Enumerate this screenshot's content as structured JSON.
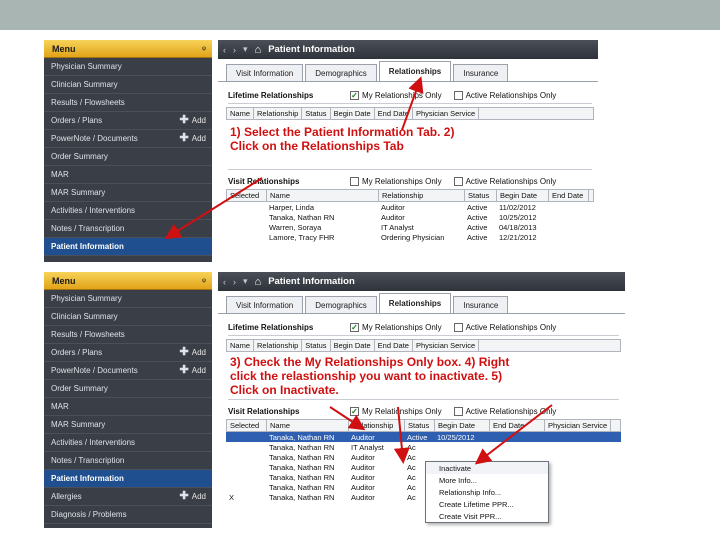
{
  "menu": {
    "header": "Menu",
    "pin": "ᵠ",
    "add_label": "Add",
    "items1": [
      {
        "label": "Physician Summary",
        "add": false
      },
      {
        "label": "Clinician Summary",
        "add": false
      },
      {
        "label": "Results / Flowsheets",
        "add": false
      },
      {
        "label": "Orders / Plans",
        "add": true
      },
      {
        "label": "PowerNote / Documents",
        "add": true
      },
      {
        "label": "Order Summary",
        "add": false
      },
      {
        "label": "MAR",
        "add": false
      },
      {
        "label": "MAR Summary",
        "add": false
      },
      {
        "label": "Activities / Interventions",
        "add": false
      },
      {
        "label": "Notes / Transcription",
        "add": false
      },
      {
        "label": "Patient Information",
        "add": false,
        "active": true
      }
    ],
    "items2": [
      {
        "label": "Physician Summary",
        "add": false
      },
      {
        "label": "Clinician Summary",
        "add": false
      },
      {
        "label": "Results / Flowsheets",
        "add": false
      },
      {
        "label": "Orders / Plans",
        "add": true
      },
      {
        "label": "PowerNote / Documents",
        "add": true
      },
      {
        "label": "Order Summary",
        "add": false
      },
      {
        "label": "MAR",
        "add": false
      },
      {
        "label": "MAR Summary",
        "add": false
      },
      {
        "label": "Activities / Interventions",
        "add": false
      },
      {
        "label": "Notes / Transcription",
        "add": false
      },
      {
        "label": "Patient Information",
        "add": false,
        "active": true
      },
      {
        "label": "Allergies",
        "add": true
      },
      {
        "label": "Diagnosis / Problems",
        "add": false
      }
    ]
  },
  "titlebar": {
    "back": "‹",
    "forward": "›",
    "dropdown": "▾",
    "title": "Patient Information"
  },
  "tabs": [
    "Visit Information",
    "Demographics",
    "Relationships",
    "Insurance"
  ],
  "lifetime": {
    "title": "Lifetime Relationships",
    "my_only": "My Relationships Only",
    "active_only": "Active Relationships Only",
    "headers": [
      "Name",
      "Relationship",
      "Status",
      "Begin Date",
      "End Date",
      "Physician Service"
    ],
    "headers2": [
      "Name",
      "Relationship",
      "Status",
      "Begin Date",
      "End Date",
      "Physician Service"
    ]
  },
  "visit": {
    "title": "Visit Relationships",
    "my_only": "My Relationships Only",
    "active_only": "Active Relationships Only",
    "headers": [
      "Selected",
      "Name",
      "Relationship",
      "Status",
      "Begin Date",
      "End Date"
    ],
    "rows": [
      {
        "name": "Harper, Linda",
        "rel": "Auditor",
        "status": "Active",
        "date": "11/02/2012"
      },
      {
        "name": "Tanaka, Nathan RN",
        "rel": "Auditor",
        "status": "Active",
        "date": "10/25/2012"
      },
      {
        "name": "Warren, Soraya",
        "rel": "IT Analyst",
        "status": "Active",
        "date": "04/18/2013"
      },
      {
        "name": "Lamore, Tracy FHR",
        "rel": "Ordering Physician",
        "status": "Active",
        "date": "12/21/2012"
      }
    ],
    "headers2": [
      "Selected",
      "Name",
      "Relationship",
      "Status",
      "Begin Date",
      "End Date",
      "Physician Service"
    ],
    "rows2": [
      {
        "sel": "",
        "name": "Tanaka, Nathan RN",
        "rel": "Auditor",
        "status": "Active",
        "date": "10/25/2012"
      },
      {
        "sel": "",
        "name": "Tanaka, Nathan RN",
        "rel": "IT Analyst",
        "status": "Ac",
        "date": ""
      },
      {
        "sel": "",
        "name": "Tanaka, Nathan RN",
        "rel": "Auditor",
        "status": "Ac",
        "date": ""
      },
      {
        "sel": "",
        "name": "Tanaka, Nathan RN",
        "rel": "Auditor",
        "status": "Ac",
        "date": ""
      },
      {
        "sel": "",
        "name": "Tanaka, Nathan RN",
        "rel": "Auditor",
        "status": "Ac",
        "date": ""
      },
      {
        "sel": "",
        "name": "Tanaka, Nathan RN",
        "rel": "Auditor",
        "status": "Ac",
        "date": ""
      },
      {
        "sel": "X",
        "name": "Tanaka, Nathan RN",
        "rel": "Auditor",
        "status": "Ac",
        "date": ""
      }
    ]
  },
  "annotation1": [
    "1) Select the Patient Information Tab. 2)",
    "Click on the Relationships Tab"
  ],
  "annotation2": [
    "3) Check the My Relationships Only box. 4) Right",
    "click the relastionship you want to inactivate. 5)",
    "Click on Inactivate."
  ],
  "context_menu": [
    "Inactivate",
    "More Info...",
    "Relationship Info...",
    "Create Lifetime PPR...",
    "Create Visit PPR..."
  ],
  "colors": {
    "annotation": "#d01010",
    "menu_bg": "#3a3e46",
    "menu_header": "#e8b02a",
    "active_item": "#1f4f8f"
  }
}
